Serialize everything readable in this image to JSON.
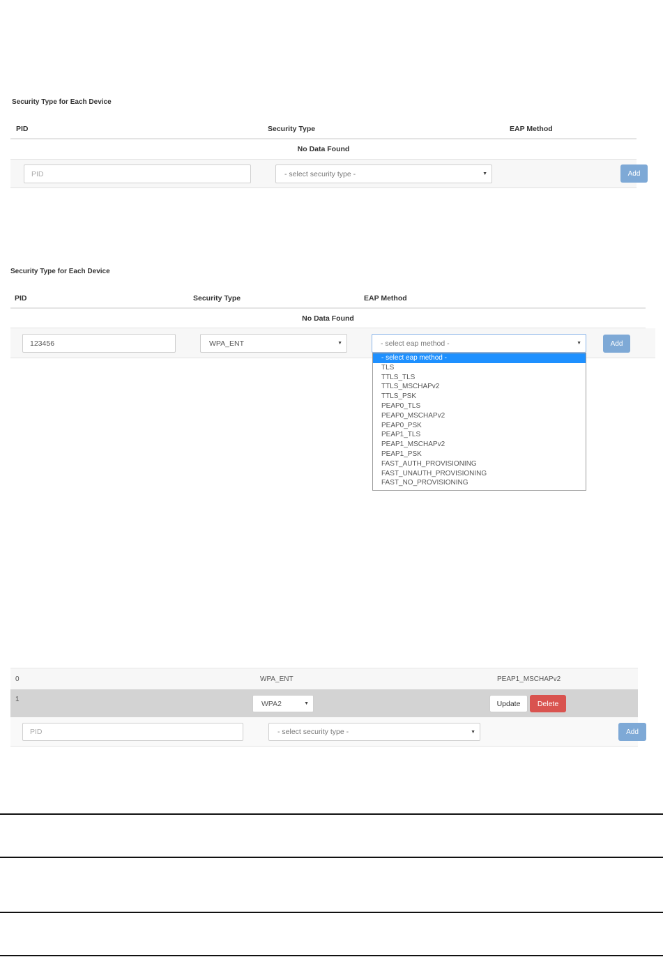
{
  "panel1": {
    "title": "Security Type for Each Device",
    "col_pid": "PID",
    "col_security": "Security Type",
    "col_eap": "EAP Method",
    "no_data": "No Data Found",
    "pid_placeholder": "PID",
    "security_select": "- select security type -",
    "add": "Add"
  },
  "panel2": {
    "title": "Security Type for Each Device",
    "col_pid": "PID",
    "col_security": "Security Type",
    "col_eap": "EAP Method",
    "no_data": "No Data Found",
    "pid_value": "123456",
    "security_select": "WPA_ENT",
    "eap_select": "- select eap method -",
    "add": "Add",
    "eap_options": [
      "- select eap method -",
      "TLS",
      "TTLS_TLS",
      "TTLS_MSCHAPv2",
      "TTLS_PSK",
      "PEAP0_TLS",
      "PEAP0_MSCHAPv2",
      "PEAP0_PSK",
      "PEAP1_TLS",
      "PEAP1_MSCHAPv2",
      "PEAP1_PSK",
      "FAST_AUTH_PROVISIONING",
      "FAST_UNAUTH_PROVISIONING",
      "FAST_NO_PROVISIONING"
    ],
    "eap_selected_index": 0
  },
  "panel3": {
    "rows": [
      {
        "pid": "0",
        "security": "WPA_ENT",
        "eap": "PEAP1_MSCHAPv2"
      },
      {
        "pid": "1",
        "security_select": "WPA2",
        "update": "Update",
        "delete": "Delete"
      }
    ],
    "pid_placeholder": "PID",
    "security_select": "- select security type -",
    "add": "Add"
  },
  "colors": {
    "add_button": "#7ea9d6",
    "delete_button": "#d9534f",
    "selected_option": "#1e90ff",
    "editing_row": "#d3d3d3"
  }
}
